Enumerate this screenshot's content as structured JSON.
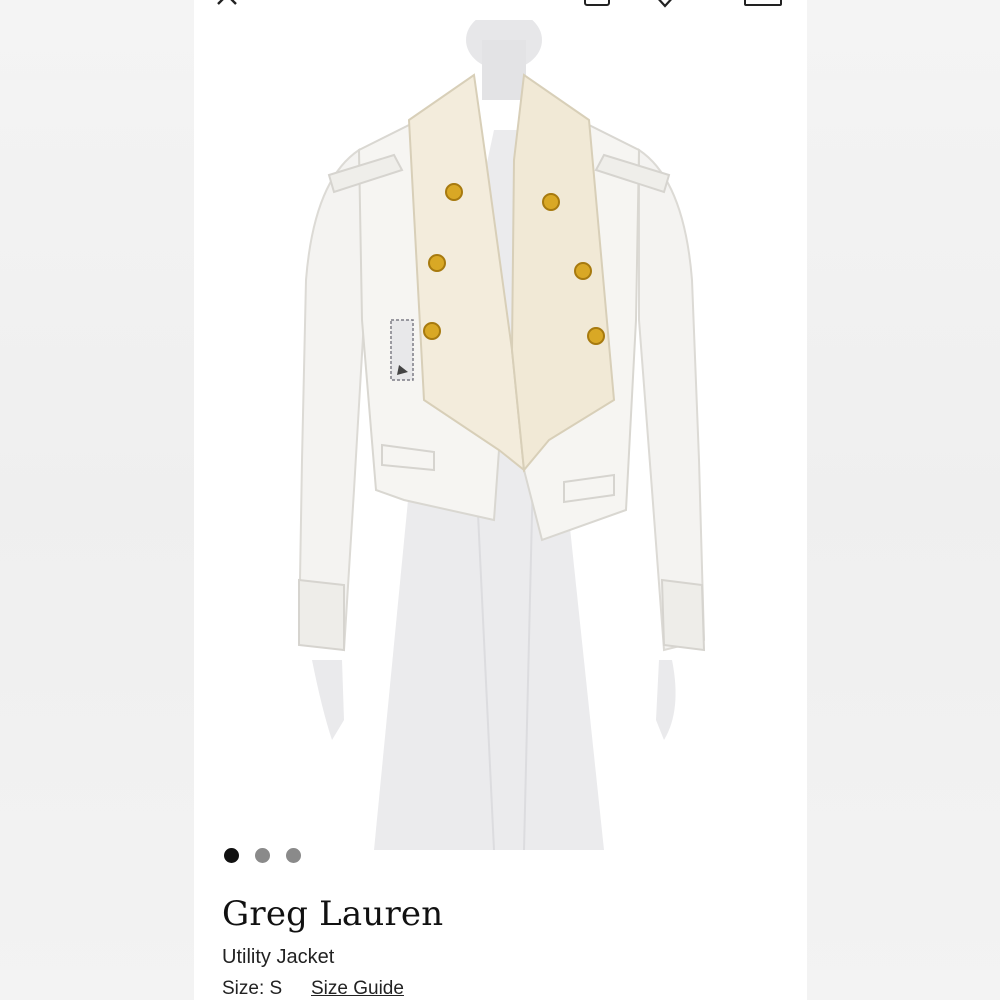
{
  "product": {
    "brand": "Greg Lauren",
    "name": "Utility Jacket",
    "size_label": "Size: S",
    "size_guide_label": "Size Guide"
  },
  "gallery": {
    "dots": [
      {
        "active": true
      },
      {
        "active": false
      },
      {
        "active": false
      }
    ]
  },
  "header_icons": [
    "close-icon",
    "bag-icon",
    "heart-icon",
    "cart-icon"
  ]
}
